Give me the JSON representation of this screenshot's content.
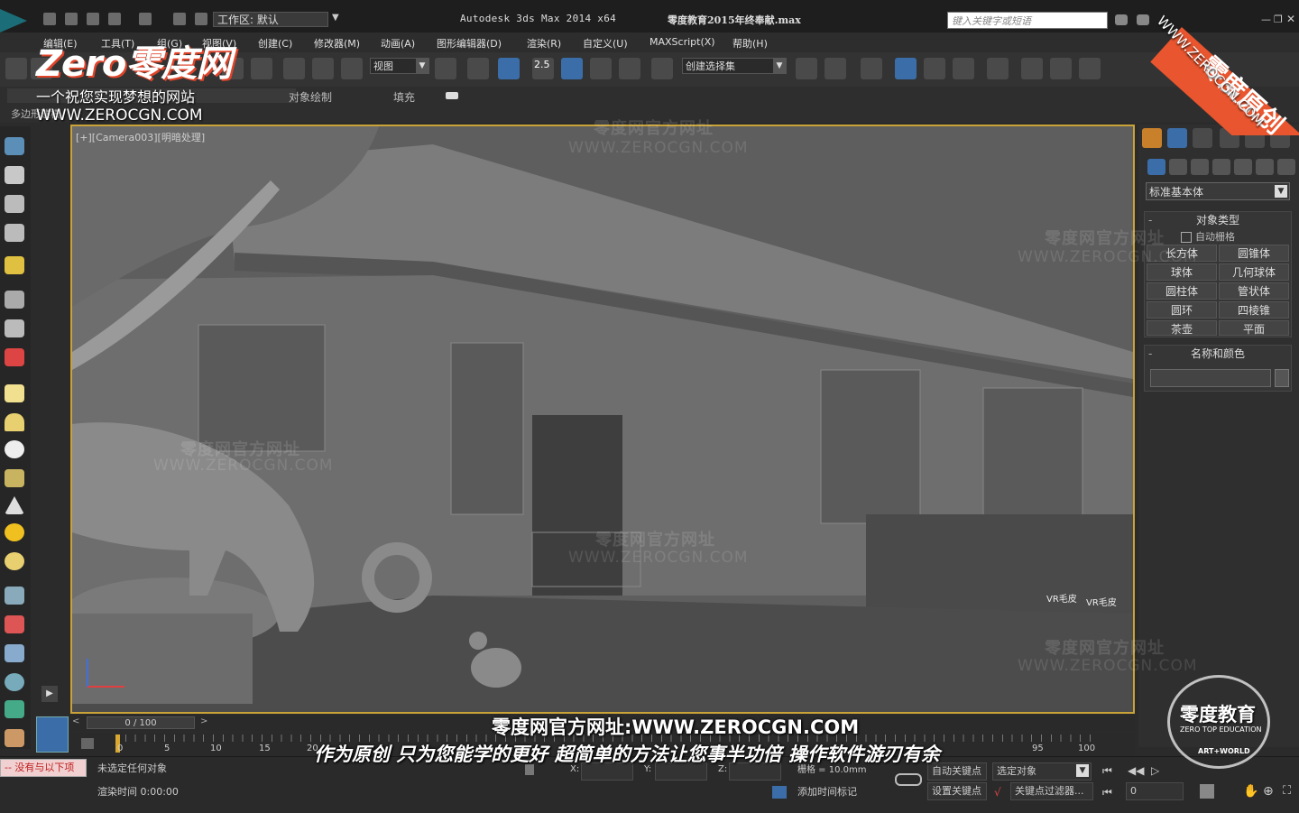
{
  "title_bar": {
    "app_title": "Autodesk 3ds Max  2014 x64",
    "file_title": "零度教育2015年终奉献.max",
    "workspace": "工作区: 默认",
    "search_placeholder": "键入关键字或短语"
  },
  "menu": [
    "编辑(E)",
    "工具(T)",
    "组(G)",
    "视图(V)",
    "创建(C)",
    "修改器(M)",
    "动画(A)",
    "图形编辑器(D)",
    "渲染(R)",
    "自定义(U)",
    "MAXScript(X)",
    "帮助(H)"
  ],
  "toolbar": {
    "view_dropdown": "视图",
    "snap_label": "2.5",
    "selection_set": "创建选择集"
  },
  "ribbon": {
    "tab_label": "多边形建模",
    "paint_label": "对象绘制",
    "fill_label": "填充"
  },
  "viewport": {
    "label": "[+][Camera003][明暗处理]"
  },
  "command_panel": {
    "category": "标准基本体",
    "object_type_header": "对象类型",
    "autogrid": "自动栅格",
    "buttons": [
      "长方体",
      "圆锥体",
      "球体",
      "几何球体",
      "圆柱体",
      "管状体",
      "圆环",
      "四棱锥",
      "茶壶",
      "平面"
    ],
    "name_color_header": "名称和颜色"
  },
  "timeline": {
    "frame_counter": "0 / 100",
    "ticks": [
      "0",
      "5",
      "10",
      "15",
      "20",
      "95",
      "100"
    ]
  },
  "status": {
    "selection": "未选定任何对象",
    "render_time": "渲染时间  0:00:00",
    "maxscript": "-- 没有与以下项",
    "x_label": "X:",
    "y_label": "Y:",
    "z_label": "Z:",
    "grid": "栅格 = 10.0mm",
    "add_time_tag": "添加时间标记",
    "auto_key": "自动关键点",
    "set_key": "设置关键点",
    "selected_dropdown": "选定对象",
    "key_filters": "关键点过滤器...",
    "frame_field": "0"
  },
  "overlays": {
    "logo_text": "Zero零度网",
    "logo_tagline": "一个祝您实现梦想的网站",
    "logo_url": "WWW.ZEROCGN.COM",
    "watermark_cn": "零度网官方网址",
    "watermark_url": "WWW.ZEROCGN.COM",
    "banner_text": "零度原创",
    "banner_url": "WWW.ZEROCGN.COM",
    "caption_line1": "零度网官方网址:WWW.ZEROCGN.COM",
    "caption_line2": "作为原创 只为您能学的更好 超简单的方法让您事半功倍 操作软件游刃有余",
    "edu_logo_title": "零度教育",
    "edu_logo_sub": "ZERO TOP EDUCATION",
    "edu_logo_badge": "ART+WORLD",
    "vr_label_1": "VR毛皮",
    "vr_label_2": "VR毛皮"
  },
  "colors": {
    "viewport_border": "#c9a238",
    "banner": "#e8552e",
    "active_tool": "#3b6ea8"
  }
}
